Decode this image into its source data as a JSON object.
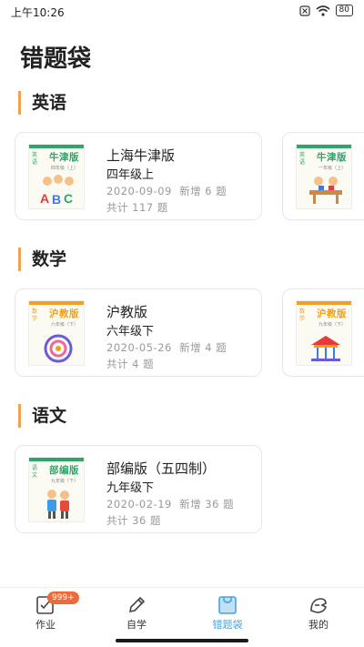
{
  "status": {
    "time": "上午10:26",
    "battery": "80"
  },
  "title": "错题袋",
  "sections": [
    {
      "title": "英语",
      "cards": [
        {
          "cover_brand": "牛津版",
          "cover_side": "英语",
          "cover_grade": "四年级（上）",
          "name": "上海牛津版",
          "grade": "四年级上",
          "date": "2020-09-09",
          "new_label": "新增 6 题",
          "total_label": "共计 117 题"
        },
        {
          "cover_brand": "牛津版",
          "cover_side": "英语",
          "cover_grade": "一年级（上）"
        }
      ]
    },
    {
      "title": "数学",
      "cards": [
        {
          "cover_brand": "沪教版",
          "cover_side": "数学",
          "cover_grade": "六年级（下）",
          "name": "沪教版",
          "grade": "六年级下",
          "date": "2020-05-26",
          "new_label": "新增 4 题",
          "total_label": "共计 4 题"
        },
        {
          "cover_brand": "沪教版",
          "cover_side": "数学",
          "cover_grade": "九年级（下）"
        }
      ]
    },
    {
      "title": "语文",
      "cards": [
        {
          "cover_brand": "部编版",
          "cover_side": "语文",
          "cover_grade": "九年级（下）",
          "name": "部编版（五四制）",
          "grade": "九年级下",
          "date": "2020-02-19",
          "new_label": "新增 36 题",
          "total_label": "共计 36 题"
        }
      ]
    }
  ],
  "tabs": [
    {
      "label": "作业",
      "badge": "999+"
    },
    {
      "label": "自学"
    },
    {
      "label": "错题袋"
    },
    {
      "label": "我的"
    }
  ],
  "colors": {
    "accent": "#f0a24e",
    "active_tab": "#4aa3df",
    "badge": "#ef6a3a",
    "cover_green": "#2ea66a",
    "cover_orange": "#f0a020"
  }
}
